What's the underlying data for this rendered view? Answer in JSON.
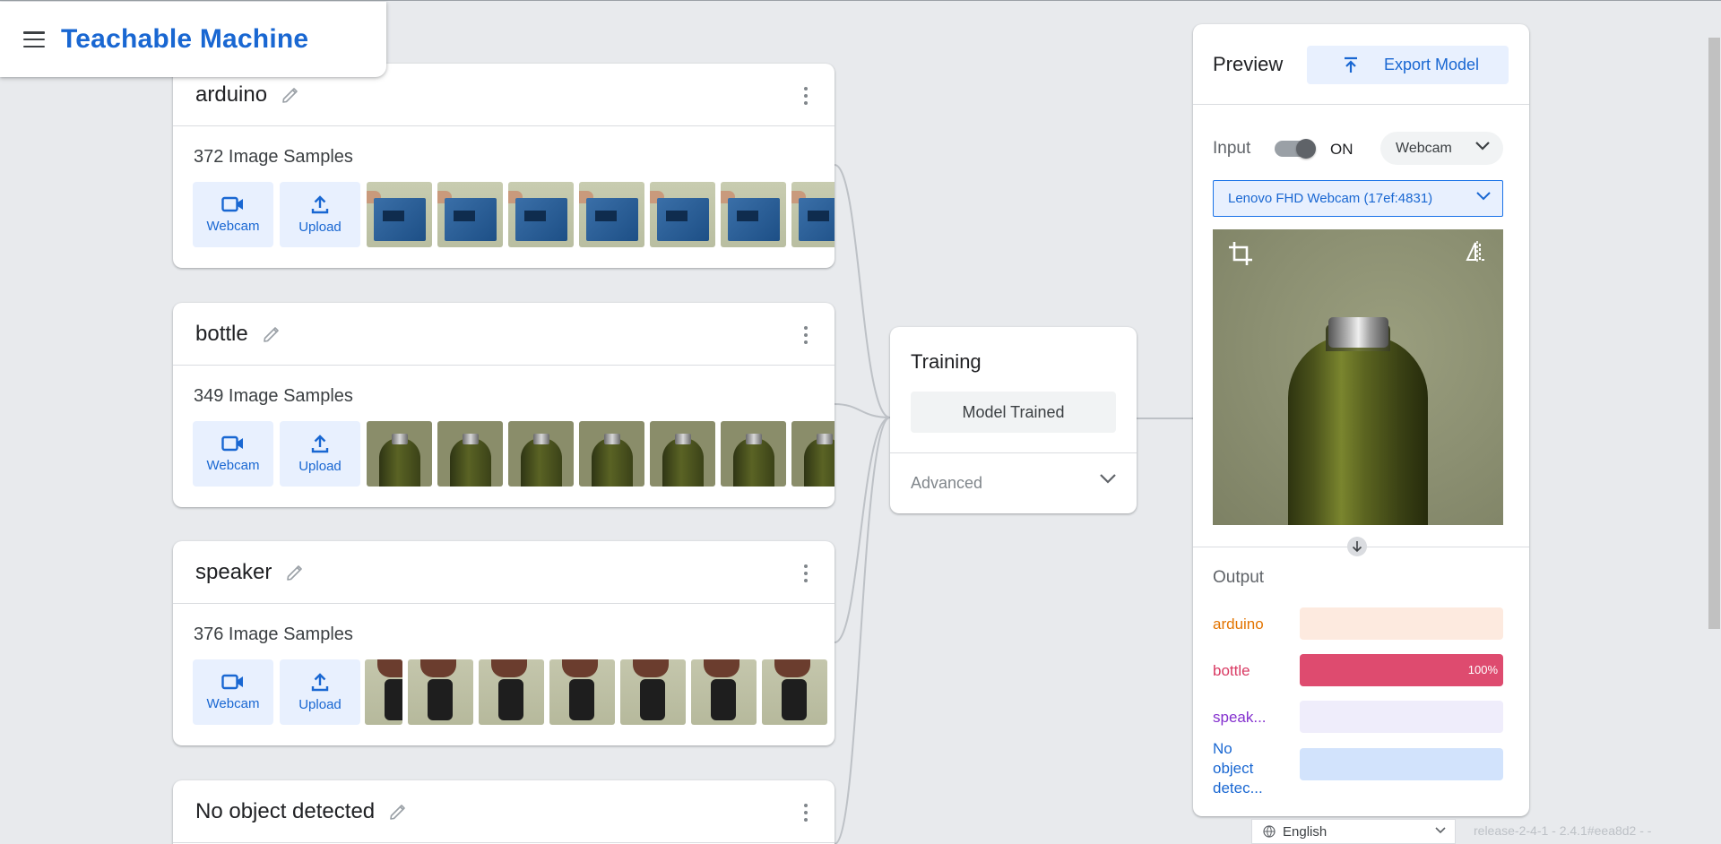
{
  "app": {
    "title": "Teachable Machine"
  },
  "classes": [
    {
      "name": "arduino",
      "samples": "372 Image Samples",
      "webcam_label": "Webcam",
      "upload_label": "Upload",
      "thumb_type": "arduino"
    },
    {
      "name": "bottle",
      "samples": "349 Image Samples",
      "webcam_label": "Webcam",
      "upload_label": "Upload",
      "thumb_type": "bottle"
    },
    {
      "name": "speaker",
      "samples": "376 Image Samples",
      "webcam_label": "Webcam",
      "upload_label": "Upload",
      "thumb_type": "speaker"
    },
    {
      "name": "No object detected"
    }
  ],
  "training": {
    "title": "Training",
    "status_button": "Model Trained",
    "advanced_label": "Advanced"
  },
  "preview": {
    "title": "Preview",
    "export_label": "Export Model",
    "input_label": "Input",
    "toggle_state": "ON",
    "source_select": "Webcam",
    "camera_select": "Lenovo FHD Webcam (17ef:4831)",
    "output_title": "Output",
    "outputs": [
      {
        "label": "arduino",
        "color": "#e37400",
        "bg": "#fdeadf",
        "fill": "#e37400",
        "value": 0,
        "pct_label": ""
      },
      {
        "label": "bottle",
        "color": "#d93a63",
        "bg": "#f9dde4",
        "fill": "#de4b6f",
        "value": 1,
        "pct_label": "100%"
      },
      {
        "label": "speak...",
        "color": "#8430ce",
        "bg": "#efedfb",
        "fill": "#8430ce",
        "value": 0,
        "pct_label": ""
      },
      {
        "label": "No object detec...",
        "color": "#1967d2",
        "bg": "#d2e3fc",
        "fill": "#1967d2",
        "value": 0,
        "pct_label": ""
      }
    ]
  },
  "footer": {
    "language": "English",
    "release": "release-2-4-1 - 2.4.1#eea8d2 - -"
  },
  "colors": {
    "accent": "#1967d2",
    "background": "#e8eaed"
  }
}
